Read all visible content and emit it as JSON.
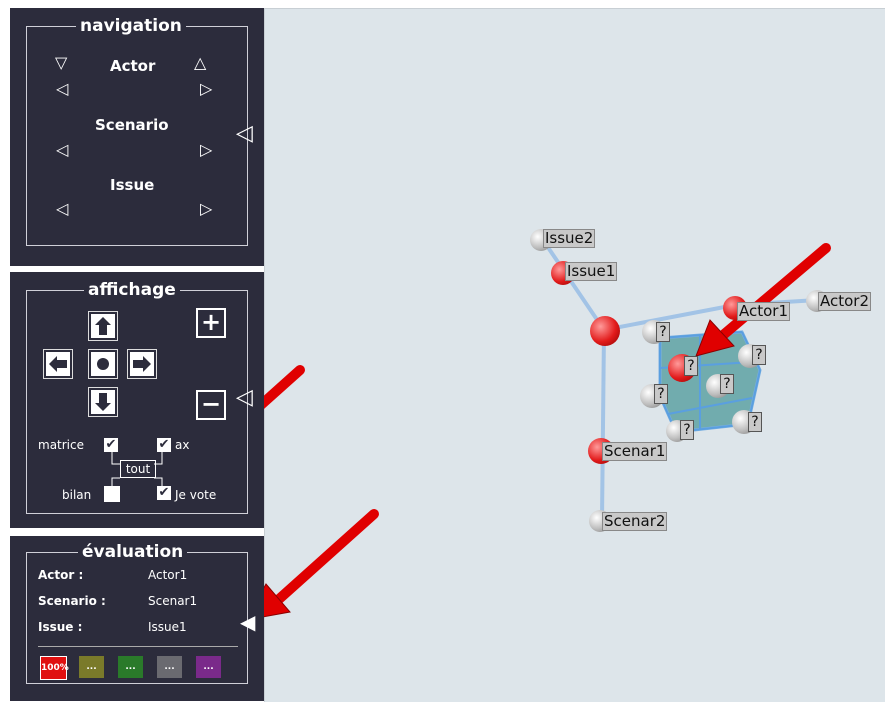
{
  "navigation": {
    "title": "navigation",
    "actor_label": "Actor",
    "scenario_label": "Scenario",
    "issue_label": "Issue"
  },
  "affichage": {
    "title": "affichage",
    "matrice_label": "matrice",
    "axes_label": "ax",
    "tout_label": "tout",
    "bilan_label": "bilan",
    "jevote_label": "Je vote",
    "plus": "+",
    "minus": "−",
    "matrice_checked": "✔",
    "axes_checked": "✔",
    "jevote_checked": "✔",
    "bilan_checked": ""
  },
  "evaluation": {
    "title": "évaluation",
    "actor_key": "Actor :",
    "actor_value": "Actor1",
    "scenario_key": "Scenario :",
    "scenario_value": "Scenar1",
    "issue_key": "Issue :",
    "issue_value": "Issue1",
    "swatches": [
      {
        "label": "100%",
        "color": "#e01010"
      },
      {
        "label": "...",
        "color": "#7a7a2a"
      },
      {
        "label": "...",
        "color": "#2a7a2a"
      },
      {
        "label": "...",
        "color": "#6a6a70"
      },
      {
        "label": "...",
        "color": "#7a2a8a"
      }
    ]
  },
  "scene": {
    "issue2": "Issue2",
    "issue1": "Issue1",
    "actor1": "Actor1",
    "actor2": "Actor2",
    "scenar1": "Scenar1",
    "scenar2": "Scenar2",
    "cell_marker": "?"
  }
}
